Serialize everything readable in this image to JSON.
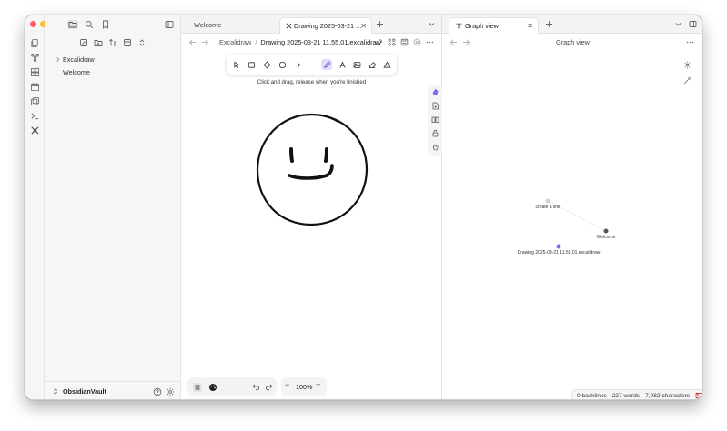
{
  "window": {
    "traffic_lights": [
      {
        "name": "close",
        "color": "#ff5f57"
      },
      {
        "name": "minimize",
        "color": "#febc2e"
      },
      {
        "name": "zoom",
        "color": "#28c840"
      }
    ]
  },
  "ribbon": {
    "icons": [
      "files-icon",
      "graph-icon",
      "canvas-icon",
      "calendar-icon",
      "templates-icon",
      "terminal-icon",
      "excalidraw-icon"
    ]
  },
  "sidebar": {
    "tree": [
      {
        "label": "Excalidraw",
        "type": "folder",
        "collapsed": true
      },
      {
        "label": "Welcome",
        "type": "file"
      }
    ],
    "vault_name": "ObsidianVault"
  },
  "left_pane": {
    "tabs": [
      {
        "label": "Welcome",
        "active": false
      },
      {
        "label": "Drawing 2025-03-21 ...",
        "active": true,
        "icon": "excalidraw-icon"
      }
    ],
    "breadcrumb": {
      "folder": "Excalidraw",
      "separator": "/",
      "file": "Drawing 2025-03-21 11.55.01.excalidraw"
    },
    "hint": "Click and drag, release when you're finished",
    "zoom": "100%",
    "tools": [
      {
        "name": "selection",
        "key": "1"
      },
      {
        "name": "rectangle",
        "key": "2"
      },
      {
        "name": "diamond",
        "key": "3"
      },
      {
        "name": "ellipse",
        "key": "4"
      },
      {
        "name": "arrow",
        "key": "5"
      },
      {
        "name": "line",
        "key": "6"
      },
      {
        "name": "draw",
        "key": "7",
        "active": true
      },
      {
        "name": "text",
        "key": "8"
      },
      {
        "name": "image",
        "key": "9"
      },
      {
        "name": "eraser",
        "key": "0"
      },
      {
        "name": "more-tools",
        "key": ""
      }
    ]
  },
  "right_pane": {
    "tabs": [
      {
        "label": "Graph view",
        "active": true
      }
    ],
    "title": "Graph view",
    "graph": {
      "nodes": [
        {
          "label": "create a link",
          "color": "#d4d4d4"
        },
        {
          "label": "Welcome",
          "color": "#555555"
        },
        {
          "label": "Drawing 2025-03-21 11.55.01.excalidraw",
          "color": "#7c6cf0"
        }
      ],
      "edges": [
        [
          "create a link",
          "Welcome"
        ]
      ]
    },
    "status": {
      "backlinks": "0 backlinks",
      "words": "227 words",
      "characters": "7,082 characters"
    }
  },
  "colors": {
    "accent": "#7c6cf0",
    "accent_bg": "#e3dcff",
    "drawing": "#111111"
  }
}
